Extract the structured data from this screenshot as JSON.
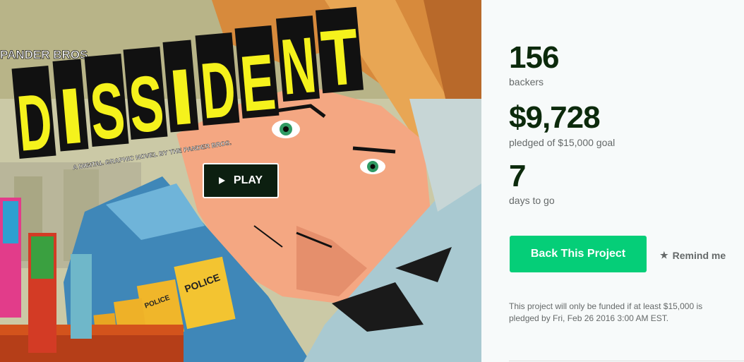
{
  "video": {
    "play_label": "PLAY",
    "art": {
      "publisher_text": "PANDER BROS.",
      "title_letters": [
        "D",
        "I",
        "S",
        "S",
        "I",
        "D",
        "E",
        "N",
        "T"
      ],
      "tagline": "A DIGITAL GRAPHIC NOVEL BY THE PANDER BROS.",
      "shield_text": "POLICE"
    }
  },
  "stats": {
    "backers_value": "156",
    "backers_label": "backers",
    "pledged_value": "$9,728",
    "pledged_label": "pledged of $15,000 goal",
    "days_value": "7",
    "days_label": "days to go"
  },
  "actions": {
    "back_label": "Back This Project",
    "remind_label": "Remind me",
    "remind_icon": "star-icon"
  },
  "fine_print": "This project will only be funded if at least $15,000 is pledged by Fri, Feb 26 2016 3:00 AM EST.",
  "colors": {
    "accent_green": "#05ce78",
    "stat_text": "#0c2a0c",
    "muted_text": "#656969",
    "play_bg": "#0c1f10"
  }
}
